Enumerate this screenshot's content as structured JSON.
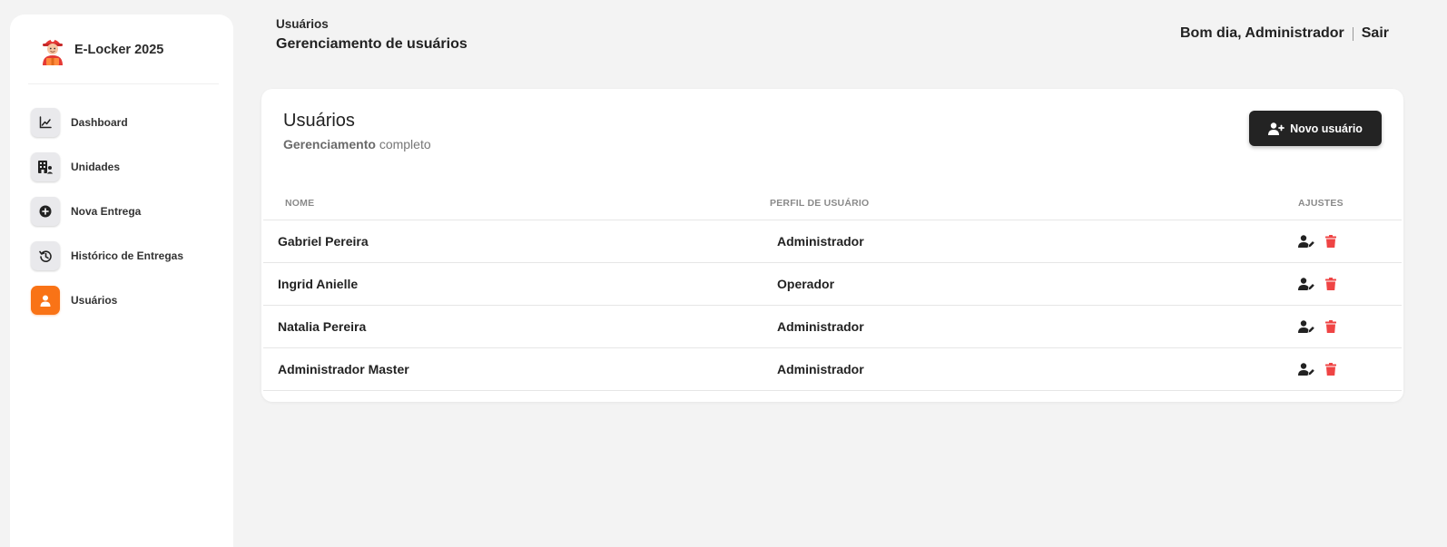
{
  "app": {
    "name": "E-Locker 2025"
  },
  "sidebar": {
    "items": [
      {
        "label": "Dashboard",
        "icon": "chart-line-icon",
        "active": false
      },
      {
        "label": "Unidades",
        "icon": "building-user-icon",
        "active": false
      },
      {
        "label": "Nova Entrega",
        "icon": "plus-circle-icon",
        "active": false
      },
      {
        "label": "Histórico de Entregas",
        "icon": "history-icon",
        "active": false
      },
      {
        "label": "Usuários",
        "icon": "user-icon",
        "active": true
      }
    ]
  },
  "header": {
    "breadcrumb": "Usuários",
    "subtitle": "Gerenciamento de usuários",
    "greeting": "Bom dia, Administrador",
    "logout_label": "Sair"
  },
  "card": {
    "title": "Usuários",
    "description_strong": "Gerenciamento",
    "description_rest": " completo",
    "new_user_label": "Novo usuário"
  },
  "table": {
    "headers": [
      "Nome",
      "Perfil de usuário",
      "Ajustes"
    ],
    "rows": [
      {
        "name": "Gabriel Pereira",
        "profile": "Administrador"
      },
      {
        "name": "Ingrid Anielle",
        "profile": "Operador"
      },
      {
        "name": "Natalia Pereira",
        "profile": "Administrador"
      },
      {
        "name": "Administrador Master",
        "profile": "Administrador"
      }
    ]
  },
  "colors": {
    "accent": "#f97316",
    "dark": "#232323",
    "danger": "#ef4444",
    "background": "#f3f3f3"
  }
}
